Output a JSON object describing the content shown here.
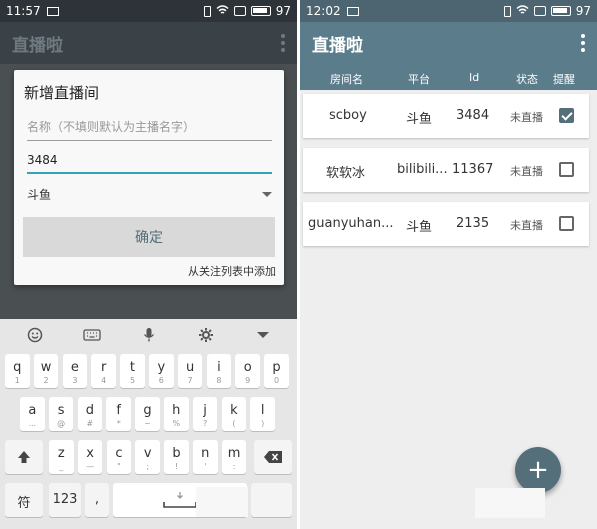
{
  "left": {
    "status": {
      "time": "11:57",
      "battery": "97"
    },
    "toolbar": {
      "title": "直播啦"
    },
    "dialog": {
      "title": "新增直播间",
      "name_placeholder": "名称（不填则默认为主播名字）",
      "id_value": "3484",
      "platform": "斗鱼",
      "confirm_label": "确定",
      "follow_link": "从关注列表中添加"
    },
    "keyboard": {
      "row1": [
        {
          "main": "q",
          "sub": "1"
        },
        {
          "main": "w",
          "sub": "2"
        },
        {
          "main": "e",
          "sub": "3"
        },
        {
          "main": "r",
          "sub": "4"
        },
        {
          "main": "t",
          "sub": "5"
        },
        {
          "main": "y",
          "sub": "6"
        },
        {
          "main": "u",
          "sub": "7"
        },
        {
          "main": "i",
          "sub": "8"
        },
        {
          "main": "o",
          "sub": "9"
        },
        {
          "main": "p",
          "sub": "0"
        }
      ],
      "row2": [
        {
          "main": "a",
          "sub": "..."
        },
        {
          "main": "s",
          "sub": "@"
        },
        {
          "main": "d",
          "sub": "#"
        },
        {
          "main": "f",
          "sub": "*"
        },
        {
          "main": "g",
          "sub": "~"
        },
        {
          "main": "h",
          "sub": "%"
        },
        {
          "main": "j",
          "sub": "?"
        },
        {
          "main": "k",
          "sub": "("
        },
        {
          "main": "l",
          "sub": ")"
        }
      ],
      "row3": [
        {
          "main": "z",
          "sub": "_"
        },
        {
          "main": "x",
          "sub": "—"
        },
        {
          "main": "c",
          "sub": "\""
        },
        {
          "main": "v",
          "sub": ";"
        },
        {
          "main": "b",
          "sub": "!"
        },
        {
          "main": "n",
          "sub": "'"
        },
        {
          "main": "m",
          "sub": ":"
        }
      ],
      "sym_label": "符",
      "num_label": "123",
      "comma_label": ","
    }
  },
  "right": {
    "status": {
      "time": "12:02",
      "battery": "97"
    },
    "toolbar": {
      "title": "直播啦"
    },
    "headers": {
      "name": "房间名",
      "platform": "平台",
      "id": "Id",
      "status": "状态",
      "remind": "提醒"
    },
    "rooms": [
      {
        "name": "scboy",
        "platform": "斗鱼",
        "id": "3484",
        "status": "未直播",
        "remind": true
      },
      {
        "name": "软软冰",
        "platform": "bilibili...",
        "id": "11367",
        "status": "未直播",
        "remind": false
      },
      {
        "name": "guanyuhan...",
        "platform": "斗鱼",
        "id": "2135",
        "status": "未直播",
        "remind": false
      }
    ],
    "fab_label": "+"
  }
}
